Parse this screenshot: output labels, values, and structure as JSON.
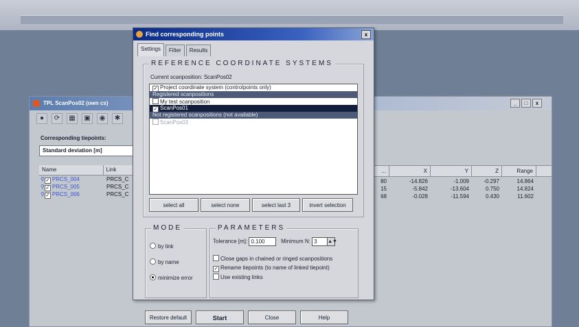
{
  "background_window": {
    "title": "TPL ScanPos02 (own cs)",
    "window_controls": [
      "_",
      "□",
      "x"
    ],
    "toolbar_icons": [
      "info-icon",
      "refresh-icon",
      "grid-icon",
      "copy-icon",
      "binoculars-icon",
      "tools-icon"
    ],
    "corresponding_label": "Corresponding tiepoints:",
    "std_dev_value": "Standard deviation [m]",
    "left_columns": [
      "Name",
      "Link"
    ],
    "left_rows": [
      {
        "name": "PRCS_004",
        "link": "PRCS_C"
      },
      {
        "name": "PRCS_005",
        "link": "PRCS_C"
      },
      {
        "name": "PRCS_006",
        "link": "PRCS_C"
      }
    ],
    "right_columns": [
      "...",
      "X",
      "Y",
      "Z",
      "Range"
    ],
    "right_rows": [
      [
        "80",
        "-14.826",
        "-1.009",
        "-0.297",
        "14.864"
      ],
      [
        "15",
        "-5.842",
        "-13.604",
        "0.750",
        "14.824"
      ],
      [
        "68",
        "-0.028",
        "-11.594",
        "0.430",
        "11.602"
      ]
    ]
  },
  "dialog": {
    "title": "Find corresponding points",
    "close": "x",
    "tabs": [
      "Settings",
      "Filter",
      "Results"
    ],
    "ref_title": "REFERENCE COORDINATE SYSTEMS",
    "current_scanposition": "Current scanposition: ScanPos02",
    "list": {
      "project": "Project coordinate system (controlpoints only)",
      "registered_header": "Registered scanpositions",
      "my_test": "My test scanposition",
      "scanpos01": "ScanPos01",
      "not_registered_header": "Not registered scanpositions (not available)",
      "scanpos03": "ScanPos03"
    },
    "buttons": {
      "select_all": "select all",
      "select_none": "select none",
      "select_last3": "select last 3",
      "invert": "invert selection"
    },
    "mode": {
      "title": "MODE",
      "by_link": "by link",
      "by_name": "by name",
      "minimize": "minimize error"
    },
    "params": {
      "title": "PARAMETERS",
      "tolerance_label": "Tolerance [m]:",
      "tolerance_value": "0.100",
      "minimum_label": "Minimum N:",
      "minimum_value": "3",
      "close_gaps": "Close gaps in chained or ringed scanpositions",
      "rename": "Rename tiepoints (to name of linked tiepoint)",
      "use_existing": "Use existing links"
    },
    "bottom": {
      "restore": "Restore default",
      "start": "Start",
      "close": "Close",
      "help": "Help"
    }
  }
}
